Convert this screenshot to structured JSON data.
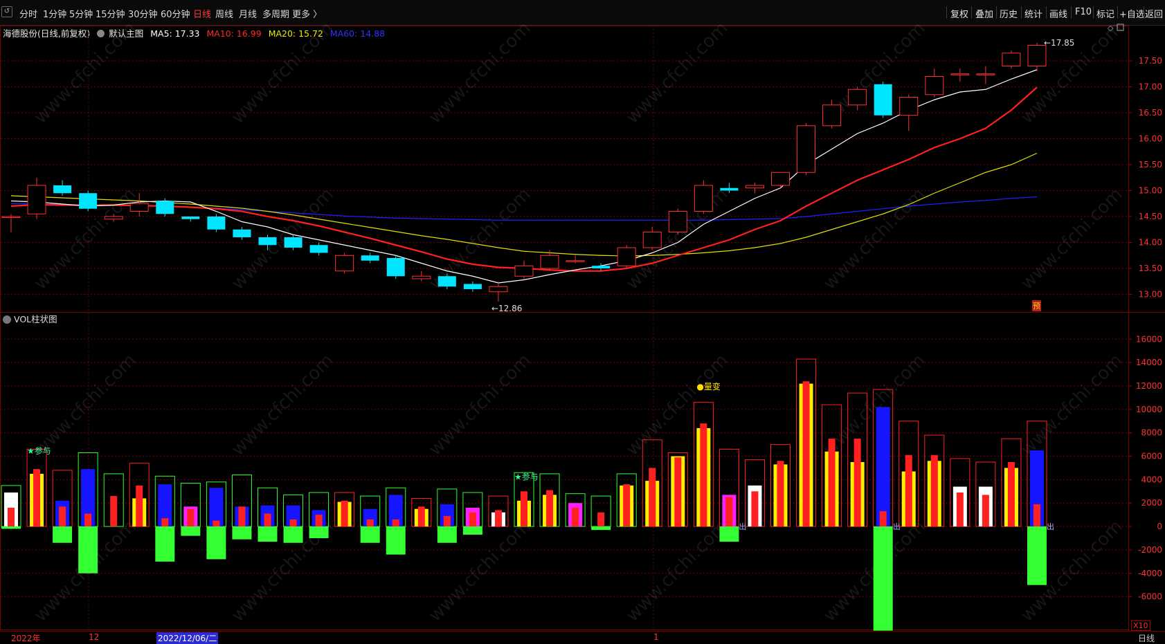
{
  "toolbar": {
    "left_items": [
      "分时",
      "1分钟",
      "5分钟",
      "15分钟",
      "30分钟",
      "60分钟",
      "日线",
      "周线",
      "月线",
      "多周期",
      "更多 〉"
    ],
    "active": "日线",
    "right_items": [
      "复权",
      "叠加",
      "历史",
      "统计",
      "画线",
      "F10",
      "标记",
      "+自选",
      "返回"
    ]
  },
  "info": {
    "stock": "海德股份(日线,前复权)",
    "main_chart": "默认主图",
    "ma5": "MA5: 17.33",
    "ma10": "MA10: 16.99",
    "ma20": "MA20: 15.72",
    "ma60": "MA60: 14.88"
  },
  "vol_title": "VOL柱状图",
  "colors": {
    "ma5": "#ffffff",
    "ma10": "#ff2020",
    "ma20": "#e0e000",
    "ma60": "#2020ff",
    "up": "#ff3030",
    "down": "#00e5ff",
    "grid": "#7a0000"
  },
  "price_axis": [
    "17.50",
    "17.00",
    "16.50",
    "16.00",
    "15.50",
    "15.00",
    "14.50",
    "14.00",
    "13.50",
    "13.00"
  ],
  "vol_axis": [
    "16000",
    "14000",
    "12000",
    "10000",
    "8000",
    "6000",
    "4000",
    "2000",
    "0",
    "-2000",
    "-4000",
    "-6000"
  ],
  "annotations": {
    "high": "17.85",
    "low": "12.86",
    "yu": "预",
    "cai1": "★参与",
    "cai2": "★参与",
    "liangbian": "●量变",
    "chu1": "出",
    "chu2": "出",
    "chu3": "出",
    "x10": "X10"
  },
  "bottom": {
    "year": "2022年",
    "month1": "12",
    "date": "2022/12/06/二",
    "month2": "1",
    "period": "日线"
  },
  "chart_data": {
    "type": "candlestick",
    "price_ylim": [
      12.7,
      17.9
    ],
    "vol_ylim": [
      -8800,
      17200
    ],
    "candles": [
      {
        "o": 14.5,
        "c": 14.5,
        "h": 14.55,
        "l": 14.2
      },
      {
        "o": 14.55,
        "c": 15.1,
        "h": 15.25,
        "l": 14.45
      },
      {
        "o": 15.1,
        "c": 14.95,
        "h": 15.2,
        "l": 14.9
      },
      {
        "o": 14.95,
        "c": 14.65,
        "h": 15.0,
        "l": 14.6
      },
      {
        "o": 14.45,
        "c": 14.5,
        "h": 14.55,
        "l": 14.4
      },
      {
        "o": 14.6,
        "c": 14.75,
        "h": 14.95,
        "l": 14.5
      },
      {
        "o": 14.8,
        "c": 14.55,
        "h": 14.85,
        "l": 14.5
      },
      {
        "o": 14.5,
        "c": 14.45,
        "h": 14.5,
        "l": 14.4
      },
      {
        "o": 14.5,
        "c": 14.25,
        "h": 14.55,
        "l": 14.2
      },
      {
        "o": 14.25,
        "c": 14.1,
        "h": 14.3,
        "l": 14.05
      },
      {
        "o": 14.1,
        "c": 13.95,
        "h": 14.15,
        "l": 13.85
      },
      {
        "o": 14.1,
        "c": 13.9,
        "h": 14.15,
        "l": 13.85
      },
      {
        "o": 13.95,
        "c": 13.8,
        "h": 14.0,
        "l": 13.75
      },
      {
        "o": 13.45,
        "c": 13.75,
        "h": 13.8,
        "l": 13.4
      },
      {
        "o": 13.75,
        "c": 13.65,
        "h": 13.8,
        "l": 13.6
      },
      {
        "o": 13.7,
        "c": 13.35,
        "h": 13.75,
        "l": 13.3
      },
      {
        "o": 13.3,
        "c": 13.35,
        "h": 13.45,
        "l": 13.25
      },
      {
        "o": 13.35,
        "c": 13.15,
        "h": 13.4,
        "l": 13.1
      },
      {
        "o": 13.2,
        "c": 13.1,
        "h": 13.25,
        "l": 13.05
      },
      {
        "o": 13.05,
        "c": 13.15,
        "h": 13.25,
        "l": 12.86
      },
      {
        "o": 13.35,
        "c": 13.55,
        "h": 13.65,
        "l": 13.3
      },
      {
        "o": 13.5,
        "c": 13.75,
        "h": 13.85,
        "l": 13.45
      },
      {
        "o": 13.65,
        "c": 13.65,
        "h": 13.75,
        "l": 13.6
      },
      {
        "o": 13.55,
        "c": 13.5,
        "h": 13.6,
        "l": 13.45
      },
      {
        "o": 13.55,
        "c": 13.9,
        "h": 13.95,
        "l": 13.5
      },
      {
        "o": 13.9,
        "c": 14.2,
        "h": 14.3,
        "l": 13.85
      },
      {
        "o": 14.2,
        "c": 14.6,
        "h": 14.65,
        "l": 14.15
      },
      {
        "o": 14.6,
        "c": 15.1,
        "h": 15.2,
        "l": 14.55
      },
      {
        "o": 15.05,
        "c": 15.0,
        "h": 15.15,
        "l": 14.95
      },
      {
        "o": 15.05,
        "c": 15.1,
        "h": 15.15,
        "l": 14.95
      },
      {
        "o": 15.1,
        "c": 15.35,
        "h": 15.35,
        "l": 15.05
      },
      {
        "o": 15.35,
        "c": 16.25,
        "h": 16.3,
        "l": 15.3
      },
      {
        "o": 16.25,
        "c": 16.65,
        "h": 16.75,
        "l": 16.2
      },
      {
        "o": 16.65,
        "c": 16.95,
        "h": 17.0,
        "l": 16.55
      },
      {
        "o": 17.05,
        "c": 16.45,
        "h": 17.1,
        "l": 16.4
      },
      {
        "o": 16.45,
        "c": 16.8,
        "h": 16.85,
        "l": 16.15
      },
      {
        "o": 16.85,
        "c": 17.2,
        "h": 17.35,
        "l": 16.8
      },
      {
        "o": 17.25,
        "c": 17.25,
        "h": 17.35,
        "l": 17.1
      },
      {
        "o": 17.25,
        "c": 17.25,
        "h": 17.4,
        "l": 17.05
      },
      {
        "o": 17.4,
        "c": 17.65,
        "h": 17.7,
        "l": 17.35
      },
      {
        "o": 17.4,
        "c": 17.8,
        "h": 17.85,
        "l": 17.3
      }
    ],
    "ma5": [
      14.8,
      14.78,
      14.74,
      14.7,
      14.72,
      14.78,
      14.8,
      14.78,
      14.6,
      14.4,
      14.3,
      14.15,
      14.05,
      13.95,
      13.85,
      13.75,
      13.6,
      13.45,
      13.35,
      13.22,
      13.28,
      13.38,
      13.47,
      13.55,
      13.65,
      13.8,
      14.0,
      14.35,
      14.6,
      14.85,
      15.05,
      15.5,
      15.8,
      16.1,
      16.3,
      16.55,
      16.75,
      16.9,
      16.95,
      17.15,
      17.33
    ],
    "ma10": [
      14.7,
      14.73,
      14.72,
      14.72,
      14.72,
      14.71,
      14.7,
      14.68,
      14.65,
      14.6,
      14.5,
      14.42,
      14.32,
      14.2,
      14.08,
      13.95,
      13.82,
      13.68,
      13.58,
      13.52,
      13.5,
      13.47,
      13.45,
      13.45,
      13.5,
      13.6,
      13.75,
      13.9,
      14.05,
      14.25,
      14.42,
      14.7,
      14.95,
      15.2,
      15.4,
      15.6,
      15.83,
      16.0,
      16.2,
      16.55,
      16.99
    ],
    "ma20": [
      14.9,
      14.88,
      14.86,
      14.84,
      14.82,
      14.8,
      14.77,
      14.74,
      14.7,
      14.66,
      14.6,
      14.53,
      14.45,
      14.37,
      14.29,
      14.21,
      14.13,
      14.06,
      13.98,
      13.9,
      13.83,
      13.8,
      13.77,
      13.75,
      13.74,
      13.75,
      13.77,
      13.8,
      13.84,
      13.9,
      13.98,
      14.1,
      14.25,
      14.4,
      14.55,
      14.73,
      14.95,
      15.15,
      15.35,
      15.5,
      15.72
    ],
    "ma60": [
      14.75,
      14.74,
      14.73,
      14.72,
      14.72,
      14.71,
      14.7,
      14.68,
      14.66,
      14.63,
      14.6,
      14.57,
      14.54,
      14.51,
      14.49,
      14.47,
      14.46,
      14.45,
      14.44,
      14.43,
      14.43,
      14.43,
      14.43,
      14.43,
      14.43,
      14.43,
      14.43,
      14.43,
      14.44,
      14.45,
      14.46,
      14.5,
      14.55,
      14.6,
      14.65,
      14.7,
      14.74,
      14.78,
      14.81,
      14.85,
      14.88
    ],
    "vol": [
      {
        "box": 3500,
        "a": 2900,
        "b": 1600,
        "ac": "#ffffff",
        "bc": "#ff2020",
        "neg": -200,
        "up": false
      },
      {
        "box": 6600,
        "a": 4500,
        "b": 4900,
        "ac": "#ffee00",
        "bc": "#ff2020",
        "neg": 0,
        "up": true
      },
      {
        "box": 4800,
        "a": 2200,
        "b": 1700,
        "ac": "#1515ff",
        "bc": "#ff2020",
        "neg": -1400,
        "up": true
      },
      {
        "box": 6300,
        "a": 4900,
        "b": 1100,
        "ac": "#1515ff",
        "bc": "#ff2020",
        "neg": -4000,
        "up": false
      },
      {
        "box": 4500,
        "a": 0,
        "b": 2600,
        "ac": "#1515ff",
        "bc": "#ff2020",
        "neg": 0,
        "up": false
      },
      {
        "box": 5400,
        "a": 2400,
        "b": 3500,
        "ac": "#ffee00",
        "bc": "#ff2020",
        "neg": 0,
        "up": true
      },
      {
        "box": 4300,
        "a": 3600,
        "b": 700,
        "ac": "#1515ff",
        "bc": "#ff2020",
        "neg": -3000,
        "up": false
      },
      {
        "box": 3700,
        "a": 1700,
        "b": 1500,
        "ac": "#ff20ff",
        "bc": "#ff2020",
        "neg": -800,
        "up": false
      },
      {
        "box": 3800,
        "a": 3300,
        "b": 500,
        "ac": "#1515ff",
        "bc": "#ff2020",
        "neg": -2800,
        "up": false
      },
      {
        "box": 4400,
        "a": 1700,
        "b": 1700,
        "ac": "#1515ff",
        "bc": "#ff2020",
        "neg": -1100,
        "up": false
      },
      {
        "box": 3300,
        "a": 1800,
        "b": 1100,
        "ac": "#1515ff",
        "bc": "#ff2020",
        "neg": -1300,
        "up": false
      },
      {
        "box": 2700,
        "a": 1800,
        "b": 600,
        "ac": "#1515ff",
        "bc": "#ff2020",
        "neg": -1400,
        "up": false
      },
      {
        "box": 2900,
        "a": 1400,
        "b": 1000,
        "ac": "#1515ff",
        "bc": "#ff2020",
        "neg": -1000,
        "up": false
      },
      {
        "box": 2900,
        "a": 2100,
        "b": 2200,
        "ac": "#ffee00",
        "bc": "#ff2020",
        "neg": 0,
        "up": true
      },
      {
        "box": 2600,
        "a": 1500,
        "b": 600,
        "ac": "#1515ff",
        "bc": "#ff2020",
        "neg": -1400,
        "up": false
      },
      {
        "box": 3300,
        "a": 2700,
        "b": 600,
        "ac": "#1515ff",
        "bc": "#ff2020",
        "neg": -2400,
        "up": false
      },
      {
        "box": 2400,
        "a": 1500,
        "b": 1700,
        "ac": "#ffee00",
        "bc": "#ff2020",
        "neg": 0,
        "up": true
      },
      {
        "box": 3200,
        "a": 1900,
        "b": 900,
        "ac": "#1515ff",
        "bc": "#ff2020",
        "neg": -1400,
        "up": false
      },
      {
        "box": 2900,
        "a": 1600,
        "b": 1200,
        "ac": "#ff20ff",
        "bc": "#ff2020",
        "neg": -700,
        "up": false
      },
      {
        "box": 2600,
        "a": 1200,
        "b": 1400,
        "ac": "#ffffff",
        "bc": "#ff2020",
        "neg": 0,
        "up": true
      },
      {
        "box": 4600,
        "a": 2200,
        "b": 3000,
        "ac": "#ffee00",
        "bc": "#ff2020",
        "neg": 0,
        "up": false
      },
      {
        "box": 4500,
        "a": 2700,
        "b": 3100,
        "ac": "#ffee00",
        "bc": "#ff2020",
        "neg": 0,
        "up": false
      },
      {
        "box": 2800,
        "a": 2000,
        "b": 1600,
        "ac": "#ff20ff",
        "bc": "#ff2020",
        "neg": 0,
        "up": false
      },
      {
        "box": 2600,
        "a": 0,
        "b": 1200,
        "ac": "#1515ff",
        "bc": "#ff2020",
        "neg": -300,
        "up": false
      },
      {
        "box": 4500,
        "a": 3500,
        "b": 3600,
        "ac": "#ffee00",
        "bc": "#ff2020",
        "neg": 0,
        "up": false
      },
      {
        "box": 7400,
        "a": 3900,
        "b": 5000,
        "ac": "#ffee00",
        "bc": "#ff2020",
        "neg": 0,
        "up": true
      },
      {
        "box": 6300,
        "a": 6000,
        "b": 5900,
        "ac": "#ffee00",
        "bc": "#ff2020",
        "neg": 0,
        "up": true
      },
      {
        "box": 10600,
        "a": 8400,
        "b": 8800,
        "ac": "#ffee00",
        "bc": "#ff2020",
        "neg": 0,
        "up": true
      },
      {
        "box": 6600,
        "a": 2700,
        "b": 2500,
        "ac": "#ff20ff",
        "bc": "#ff2020",
        "neg": -1300,
        "up": true
      },
      {
        "box": 5700,
        "a": 3500,
        "b": 3000,
        "ac": "#ffffff",
        "bc": "#ff2020",
        "neg": 0,
        "up": true
      },
      {
        "box": 7000,
        "a": 5300,
        "b": 5600,
        "ac": "#ffee00",
        "bc": "#ff2020",
        "neg": 0,
        "up": true
      },
      {
        "box": 14300,
        "a": 12200,
        "b": 12400,
        "ac": "#ffee00",
        "bc": "#ff2020",
        "neg": 0,
        "up": true
      },
      {
        "box": 10400,
        "a": 6400,
        "b": 7500,
        "ac": "#ffee00",
        "bc": "#ff2020",
        "neg": 0,
        "up": true
      },
      {
        "box": 11400,
        "a": 5500,
        "b": 7500,
        "ac": "#ffee00",
        "bc": "#ff2020",
        "neg": 0,
        "up": true
      },
      {
        "box": 11700,
        "a": 10200,
        "b": 1300,
        "ac": "#1515ff",
        "bc": "#ff2020",
        "neg": -8900,
        "up": true
      },
      {
        "box": 9000,
        "a": 4700,
        "b": 6100,
        "ac": "#ffee00",
        "bc": "#ff2020",
        "neg": 0,
        "up": true
      },
      {
        "box": 7800,
        "a": 5600,
        "b": 6100,
        "ac": "#ffee00",
        "bc": "#ff2020",
        "neg": 0,
        "up": true
      },
      {
        "box": 5800,
        "a": 3400,
        "b": 2900,
        "ac": "#ffffff",
        "bc": "#ff2020",
        "neg": 0,
        "up": true
      },
      {
        "box": 5500,
        "a": 3400,
        "b": 2700,
        "ac": "#ffffff",
        "bc": "#ff2020",
        "neg": 0,
        "up": true
      },
      {
        "box": 7500,
        "a": 5000,
        "b": 5500,
        "ac": "#ffee00",
        "bc": "#ff2020",
        "neg": 0,
        "up": true
      },
      {
        "box": 9000,
        "a": 6500,
        "b": 1900,
        "ac": "#1515ff",
        "bc": "#ff2020",
        "neg": -5000,
        "up": true
      }
    ]
  }
}
